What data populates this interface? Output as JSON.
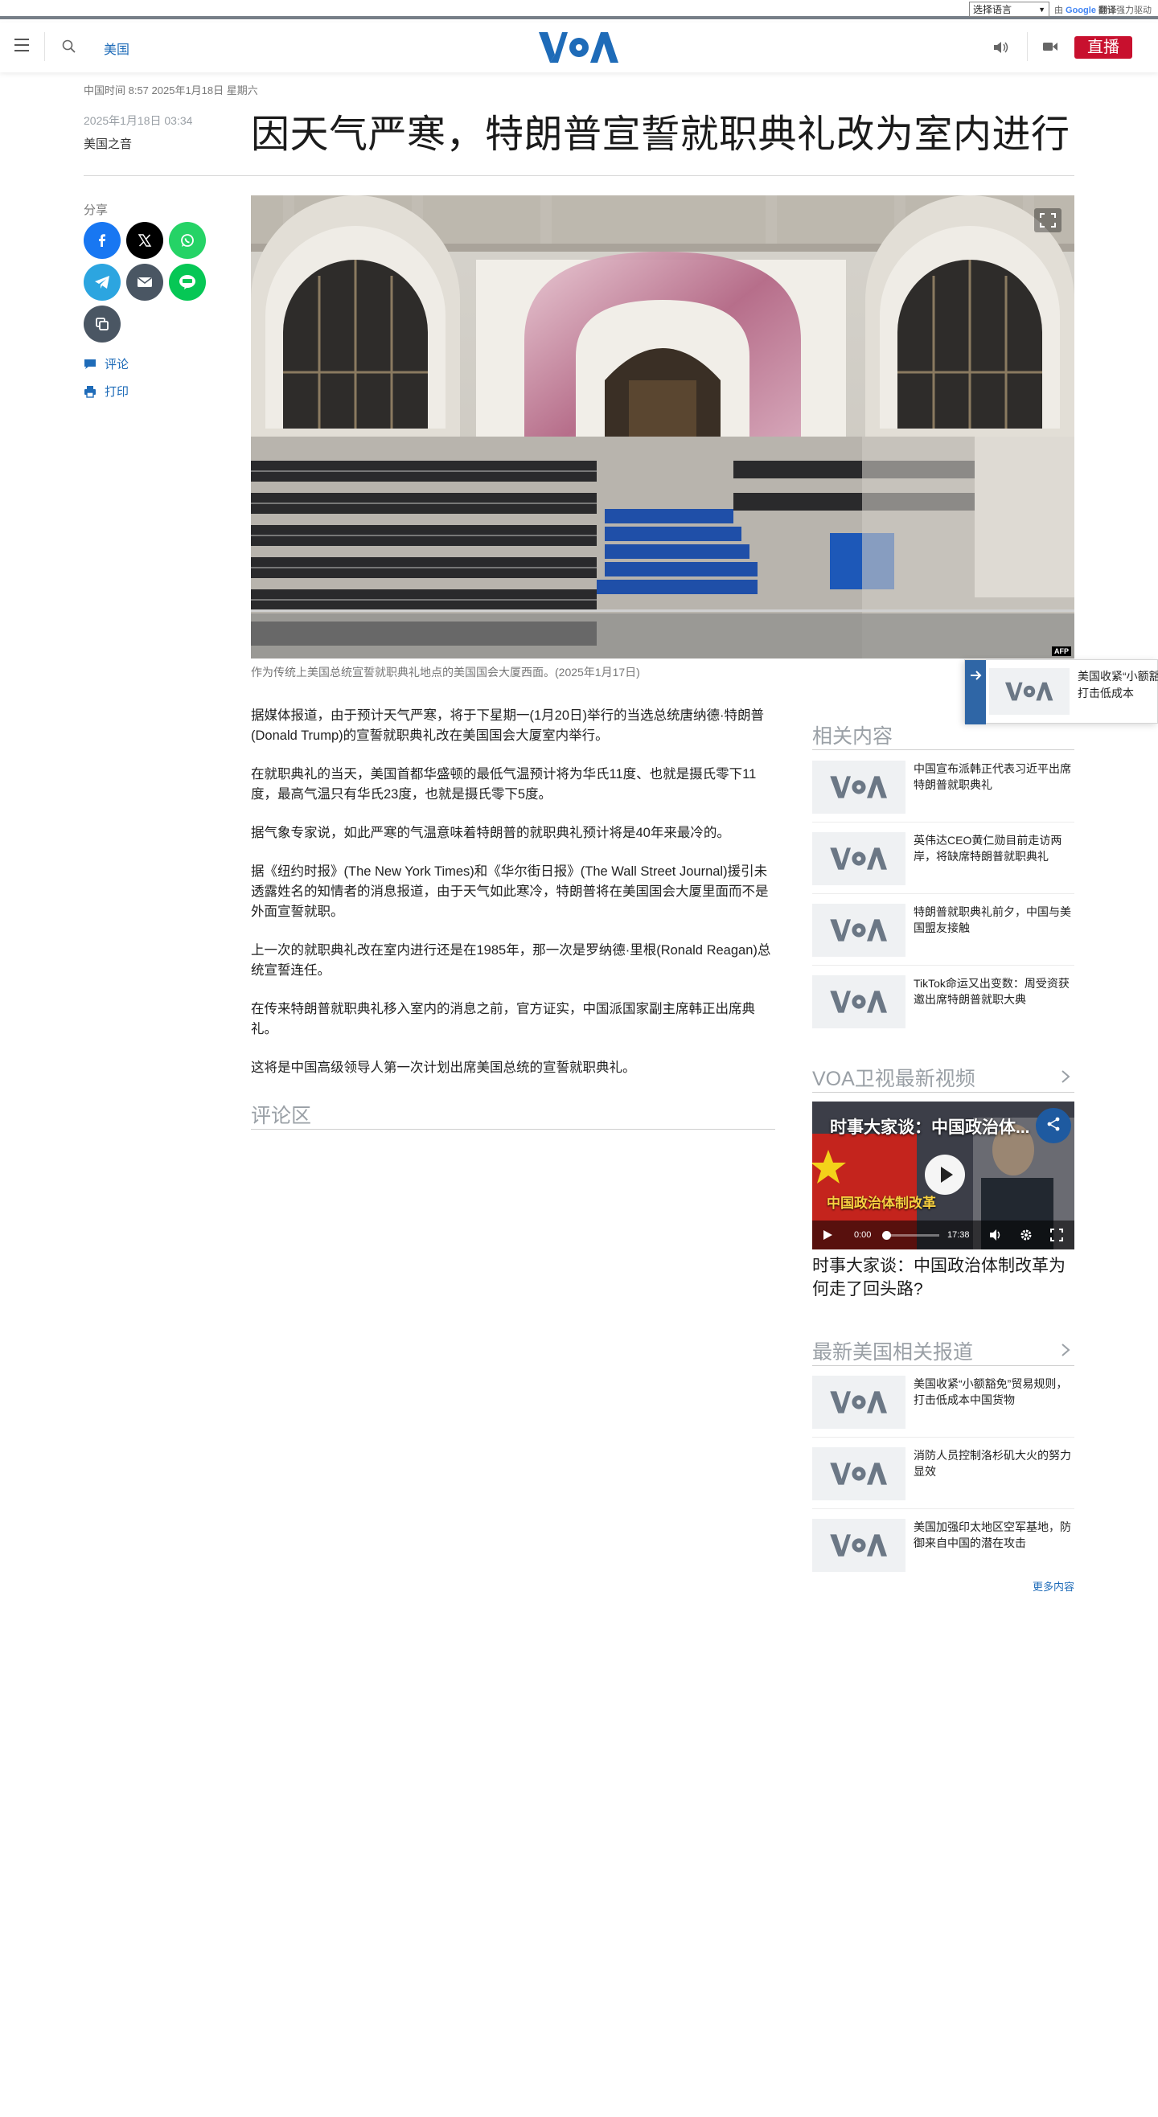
{
  "translate": {
    "select_value": "选择语言",
    "by_label": "由",
    "google_label": "Google",
    "translate_label": "翻译",
    "powered_label": "强力驱动"
  },
  "header": {
    "section": "美国",
    "live_label": "直播",
    "logo_alt": "VOA"
  },
  "timestamp": "中国时间 8:57 2025年1月18日 星期六",
  "article": {
    "pub_date": "2025年1月18日 03:34",
    "author": "美国之音",
    "title": "因天气严寒，特朗普宣誓就职典礼改为室内进行",
    "image_credit": "AFP",
    "caption": "作为传统上美国总统宣誓就职典礼地点的美国国会大厦西面。(2025年1月17日)",
    "paragraphs": [
      "据媒体报道，由于预计天气严寒，将于下星期一(1月20日)举行的当选总统唐纳德·特朗普(Donald Trump)的宣誓就职典礼改在美国国会大厦室内举行。",
      "在就职典礼的当天，美国首都华盛顿的最低气温预计将为华氏11度、也就是摄氏零下11度，最高气温只有华氏23度，也就是摄氏零下5度。",
      "据气象专家说，如此严寒的气温意味着特朗普的就职典礼预计将是40年来最冷的。",
      "据《纽约时报》(The New York Times)和《华尔街日报》(The Wall Street Journal)援引未透露姓名的知情者的消息报道，由于天气如此寒冷，特朗普将在美国国会大厦里面而不是外面宣誓就职。",
      "上一次的就职典礼改在室内进行还是在1985年，那一次是罗纳德·里根(Ronald Reagan)总统宣誓连任。",
      "在传来特朗普就职典礼移入室内的消息之前，官方证实，中国派国家副主席韩正出席典礼。",
      "这将是中国高级领导人第一次计划出席美国总统的宣誓就职典礼。"
    ],
    "comments_heading": "评论区"
  },
  "share": {
    "label": "分享",
    "comment_label": "评论",
    "print_label": "打印"
  },
  "floating_card": {
    "text": "美国收紧“小额豁免”贸易规则，打击低成本"
  },
  "related": {
    "heading": "相关内容",
    "items": [
      {
        "title": "中国宣布派韩正代表习近平出席特朗普就职典礼"
      },
      {
        "title": "英伟达CEO黄仁勋目前走访两岸，将缺席特朗普就职典礼"
      },
      {
        "title": "特朗普就职典礼前夕，中国与美国盟友接触"
      },
      {
        "title": "TikTok命运又出变数：周受资获邀出席特朗普就职大典"
      }
    ]
  },
  "video_section": {
    "heading": "VOA卫视最新视频",
    "overlay_title": "时事大家谈：中国政治体...",
    "current_time": "0:00",
    "duration": "17:38",
    "banner_text": "中国政治体制改革",
    "caption": "时事大家谈：中国政治体制改革为何走了回头路?"
  },
  "latest": {
    "heading": "最新美国相关报道",
    "items": [
      {
        "title": "美国收紧“小额豁免”贸易规则，打击低成本中国货物"
      },
      {
        "title": "消防人员控制洛杉矶大火的努力显效"
      },
      {
        "title": "美国加强印太地区空军基地，防御来自中国的潜在攻击"
      }
    ],
    "more_label": "更多内容"
  }
}
